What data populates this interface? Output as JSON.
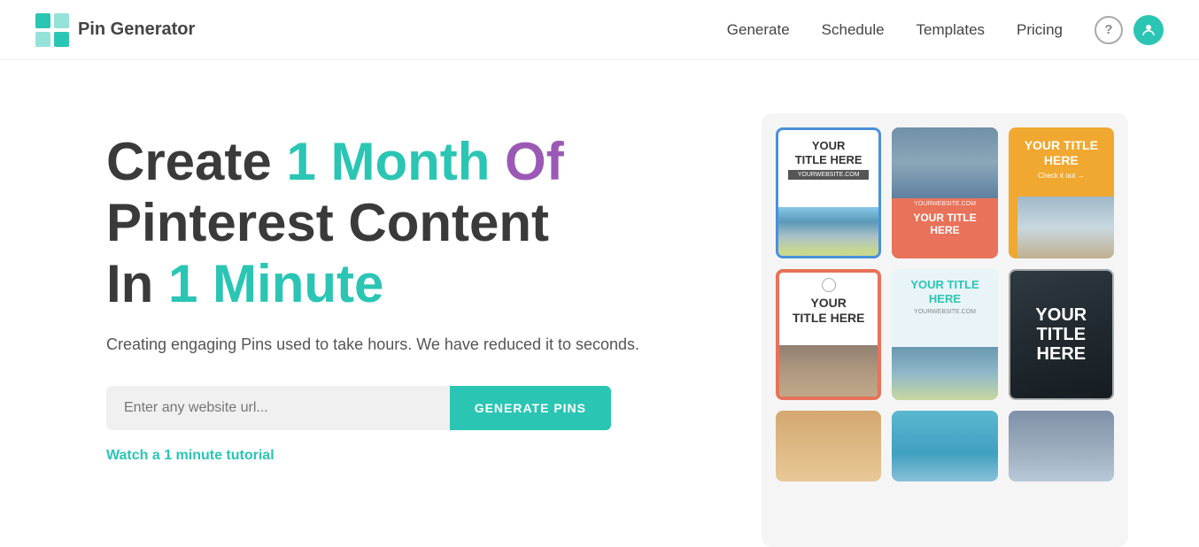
{
  "header": {
    "logo_text": "Pin Generator",
    "nav": {
      "generate": "Generate",
      "schedule": "Schedule",
      "templates": "Templates",
      "pricing": "Pricing"
    }
  },
  "hero": {
    "headline_part1": "Create ",
    "headline_1_month": "1 Month",
    "headline_part2": " Of\nPinterest Content\nIn ",
    "headline_1_minute": "1 Minute",
    "subtext": "Creating engaging Pins used to take hours. We have reduced it to seconds.",
    "url_placeholder": "Enter any website url...",
    "generate_button": "GENERATE PINS",
    "tutorial_link": "Watch a 1 minute tutorial"
  },
  "pin_cards": [
    {
      "title": "YOUR\nTITLE HERE",
      "site": "YOURWEBSITE.COM",
      "style": "white-border-blue"
    },
    {
      "title": "YOUR TITLE\nHERE",
      "site": "YOURWEBSITE.COM",
      "style": "coral-photo-top"
    },
    {
      "title": "YOUR TITLE\nHERE",
      "cta": "Check it out →",
      "style": "amber-photo-bottom"
    },
    {
      "title": "YOUR\nTITLE HERE",
      "style": "white-salmon-border"
    },
    {
      "title": "YOUR TITLE\nHERE",
      "site": "YOURWEBSITE.COM",
      "style": "light-blue-teal-text"
    },
    {
      "title": "YOUR\nTITLE\nHERE",
      "style": "dark-bold"
    }
  ]
}
